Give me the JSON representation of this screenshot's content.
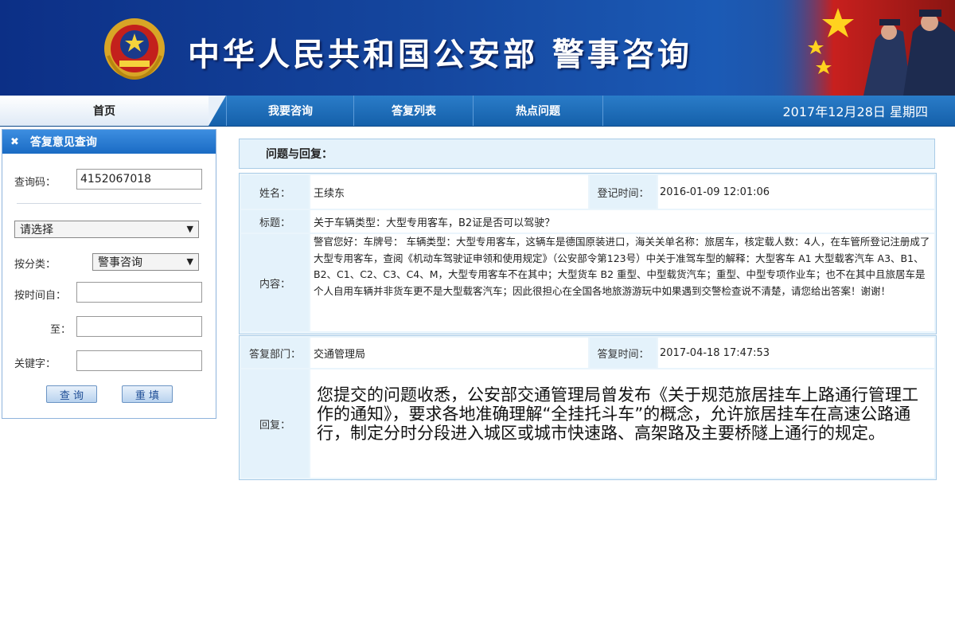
{
  "header": {
    "title": "中华人民共和国公安部  警事咨询",
    "emblem_icon": "police-emblem-icon",
    "flag_icon": "flag-image"
  },
  "nav": {
    "home": "首页",
    "items": [
      "我要咨询",
      "答复列表",
      "热点问题"
    ],
    "date": "2017年12月28日 星期四"
  },
  "query_panel": {
    "title": "答复意见查询",
    "code_label": "查询码：",
    "code_value": "4152067018",
    "select_default": "请选择",
    "category_label": "按分类：",
    "category_value": "警事咨询",
    "time_from_label": "按时间自：",
    "time_to_label": "至：",
    "keyword_label": "关键字：",
    "search_button": "查 询",
    "reset_button": "重 填"
  },
  "qa": {
    "title": "问题与回复：",
    "name_label": "姓名：",
    "name_value": "王续东",
    "reg_time_label": "登记时间：",
    "reg_time_value": "2016-01-09 12:01:06",
    "subject_label": "标题：",
    "subject_value": "关于车辆类型：大型专用客车，B2证是否可以驾驶？",
    "content_label": "内容：",
    "content_value": "警官您好：车牌号：                车辆类型：大型专用客车，这辆车是德国原装进口，海关关单名称：旅居车，核定载人数：4人，在车管所登记注册成了大型专用客车，查阅《机动车驾驶证申领和使用规定》（公安部令第123号）中关于准驾车型的解释：大型客车 A1 大型载客汽车 A3、B1、B2、C1、C2、C3、C4、M，大型专用客车不在其中；大型货车 B2 重型、中型载货汽车；重型、中型专项作业车；也不在其中且旅居车是个人自用车辆并非货车更不是大型载客汽车；因此很担心在全国各地旅游游玩中如果遇到交警检查说不清楚，请您给出答案！谢谢！",
    "dept_label": "答复部门：",
    "dept_value": "交通管理局",
    "reply_time_label": "答复时间：",
    "reply_time_value": "2017-04-18 17:47:53",
    "reply_label": "回复：",
    "reply_value": "您提交的问题收悉，公安部交通管理局曾发布《关于规范旅居挂车上路通行管理工作的通知》，要求各地准确理解“全挂托斗车”的概念，允许旅居挂车在高速公路通行，制定分时分段进入城区或城市快速路、高架路及主要桥隧上通行的规定。"
  }
}
